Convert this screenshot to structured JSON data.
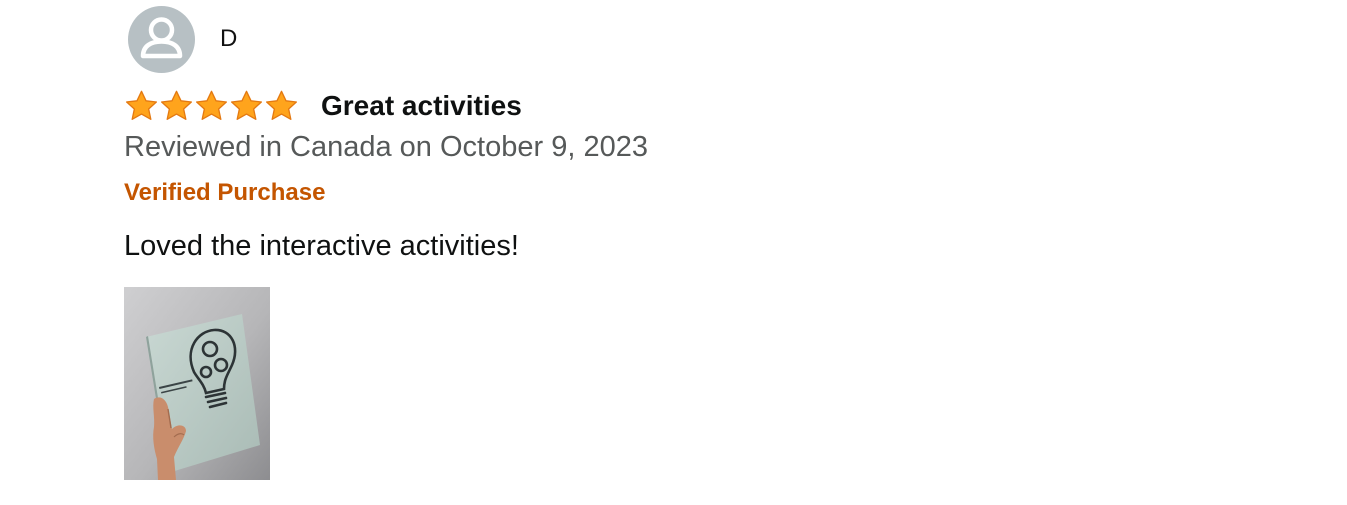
{
  "review": {
    "reviewer_name": "D",
    "rating": 5,
    "rating_max": 5,
    "title": "Great activities",
    "meta": "Reviewed in Canada on October 9, 2023",
    "badge": "Verified Purchase",
    "body": "Loved the interactive activities!",
    "images": [
      {
        "name": "customer-image-book"
      }
    ]
  },
  "colors": {
    "star": "#ff9900",
    "badge": "#c45500",
    "meta_text": "#565959",
    "avatar_bg": "#b7c0c4"
  }
}
